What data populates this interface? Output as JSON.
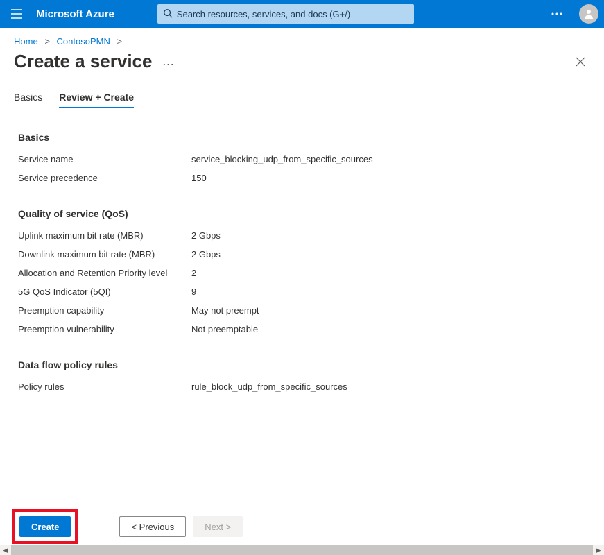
{
  "header": {
    "brand": "Microsoft Azure",
    "search_placeholder": "Search resources, services, and docs (G+/)"
  },
  "breadcrumb": {
    "home": "Home",
    "resource": "ContosoPMN"
  },
  "page": {
    "title": "Create a service"
  },
  "tabs": [
    {
      "label": "Basics"
    },
    {
      "label": "Review + Create"
    }
  ],
  "sections": {
    "basics": {
      "heading": "Basics",
      "service_name_label": "Service name",
      "service_name_value": "service_blocking_udp_from_specific_sources",
      "service_precedence_label": "Service precedence",
      "service_precedence_value": "150"
    },
    "qos": {
      "heading": "Quality of service (QoS)",
      "uplink_mbr_label": "Uplink maximum bit rate (MBR)",
      "uplink_mbr_value": "2 Gbps",
      "downlink_mbr_label": "Downlink maximum bit rate (MBR)",
      "downlink_mbr_value": "2 Gbps",
      "arp_label": "Allocation and Retention Priority level",
      "arp_value": "2",
      "fiveqi_label": "5G QoS Indicator (5QI)",
      "fiveqi_value": "9",
      "preempt_cap_label": "Preemption capability",
      "preempt_cap_value": "May not preempt",
      "preempt_vul_label": "Preemption vulnerability",
      "preempt_vul_value": "Not preemptable"
    },
    "rules": {
      "heading": "Data flow policy rules",
      "policy_rules_label": "Policy rules",
      "policy_rules_value": "rule_block_udp_from_specific_sources"
    }
  },
  "footer": {
    "create_label": "Create",
    "previous_label": "< Previous",
    "next_label": "Next >"
  }
}
